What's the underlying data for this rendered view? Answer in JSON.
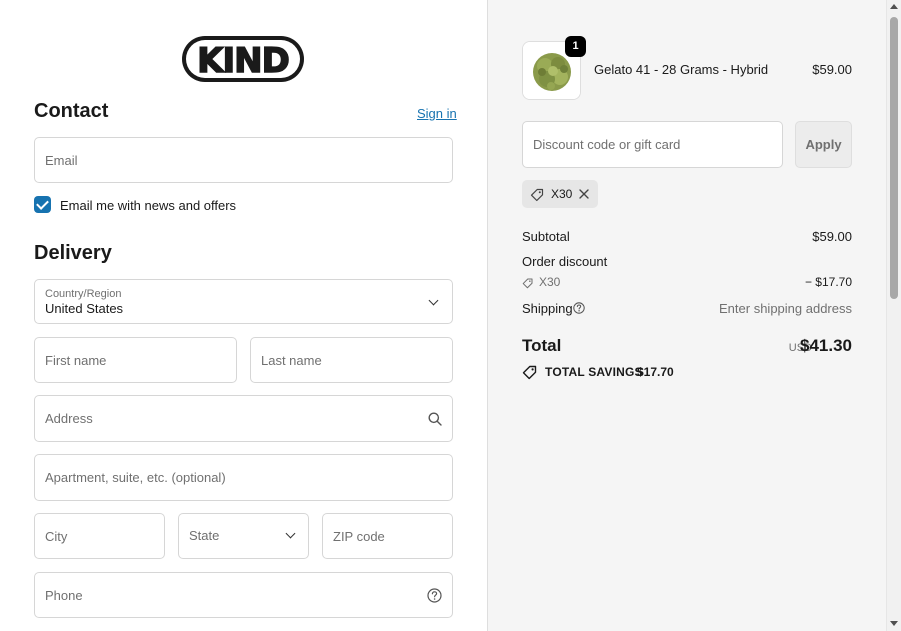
{
  "brand": {
    "logo_text": "KIND"
  },
  "contact": {
    "heading": "Contact",
    "sign_in": "Sign in",
    "email_placeholder": "Email",
    "newsletter_label": "Email me with news and offers",
    "newsletter_checked": true
  },
  "delivery": {
    "heading": "Delivery",
    "country_label": "Country/Region",
    "country_value": "United States",
    "first_name_placeholder": "First name",
    "last_name_placeholder": "Last name",
    "address_placeholder": "Address",
    "apartment_placeholder": "Apartment, suite, etc. (optional)",
    "city_placeholder": "City",
    "state_label": "State",
    "zip_placeholder": "ZIP code",
    "phone_placeholder": "Phone"
  },
  "order": {
    "item": {
      "quantity": "1",
      "name": "Gelato 41 - 28 Grams - Hybrid",
      "price": "$59.00"
    },
    "discount_placeholder": "Discount code or gift card",
    "apply_label": "Apply",
    "applied_code": "X30",
    "subtotal_label": "Subtotal",
    "subtotal_value": "$59.00",
    "order_discount_label": "Order discount",
    "discount_code": "X30",
    "discount_value": "− $17.70",
    "shipping_label": "Shipping",
    "shipping_value": "Enter shipping address",
    "total_label": "Total",
    "total_currency": "USD",
    "total_value": "$41.30",
    "savings_label": "TOTAL SAVINGS",
    "savings_value": "$17.70"
  },
  "colors": {
    "accent": "#1773b0",
    "summary_bg": "#f5f5f5"
  }
}
